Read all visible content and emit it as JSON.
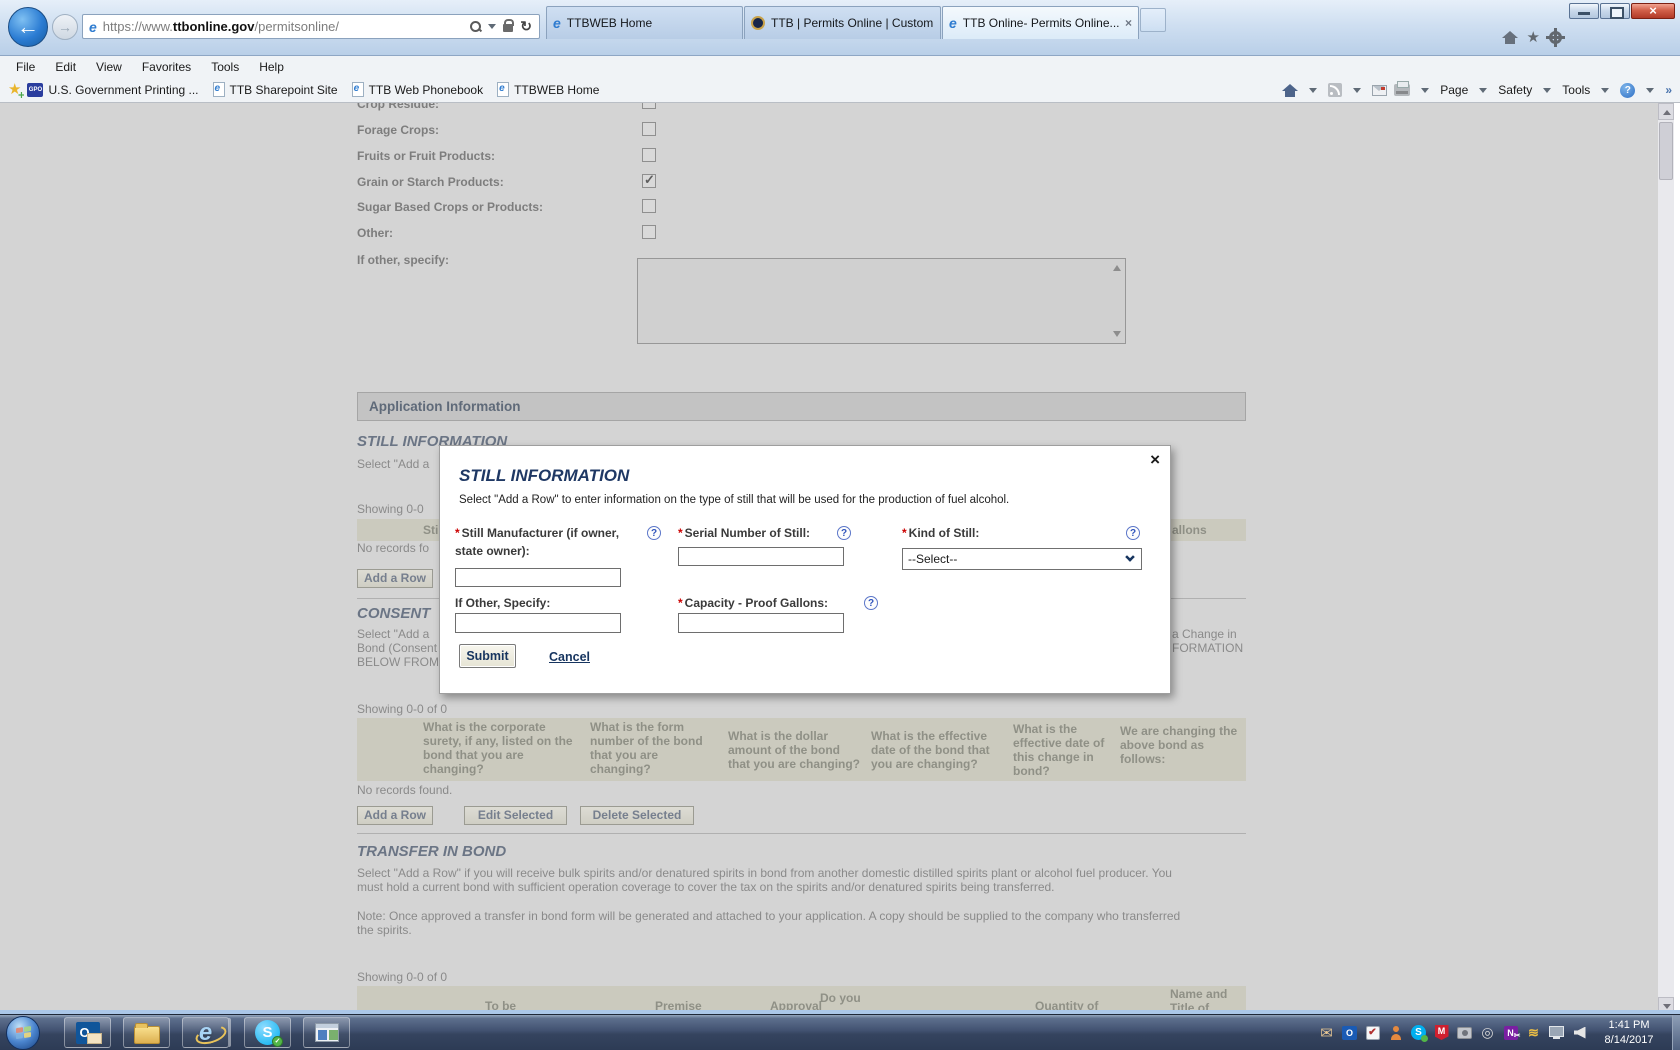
{
  "colors": {
    "accent_navy": "#1f3864",
    "required_red": "#cc0000",
    "help_blue": "#2f54bc",
    "page_dim_bg": "#d4d4d4",
    "band_bg": "#cbcabe",
    "chrome_blue": "#bfd4ea"
  },
  "icons": {
    "back": "←",
    "forward": "→",
    "refresh": "↻",
    "ie": "e",
    "star": "★",
    "check": "✓",
    "close_x": "×",
    "more": "»",
    "mail": "✉",
    "target": "◎",
    "swoosh": "≋",
    "scissors": "✂",
    "question": "?",
    "skype_s": "S",
    "outlook_o": "O",
    "mcafee_m": "M",
    "onenote_n": "N",
    "task_check": "✔"
  },
  "browser": {
    "address": {
      "prefix": "https://www.",
      "domain": "ttbonline.gov",
      "path": "/permitsonline/"
    },
    "tabs": [
      {
        "label": "TTBWEB Home"
      },
      {
        "label": "TTB | Permits Online | Custom..."
      },
      {
        "label": "TTB Online- Permits Online..."
      }
    ],
    "menu": [
      "File",
      "Edit",
      "View",
      "Favorites",
      "Tools",
      "Help"
    ],
    "favorites_badge": "GPO",
    "favorites": [
      "U.S. Government Printing ...",
      "TTB Sharepoint Site",
      "TTB Web Phonebook",
      "TTBWEB Home"
    ],
    "commands": {
      "page": "Page",
      "safety": "Safety",
      "tools": "Tools"
    }
  },
  "page": {
    "checkbox_rows": [
      {
        "label": "Crop Residue:",
        "checked": false
      },
      {
        "label": "Forage Crops:",
        "checked": false
      },
      {
        "label": "Fruits or Fruit Products:",
        "checked": false
      },
      {
        "label": "Grain or Starch Products:",
        "checked": true
      },
      {
        "label": "Sugar Based Crops or Products:",
        "checked": false
      },
      {
        "label": "Other:",
        "checked": false
      }
    ],
    "if_other_label": "If other, specify:",
    "app_info_title": "Application Information",
    "still": {
      "heading": "STILL INFORMATION",
      "intro_fragment": "Select \"Add a",
      "showing_fragment": "Showing 0-0",
      "header_left_fragment": "Stil",
      "header_right_fragment": "allons",
      "no_records_fragment": "No records fo",
      "add_row": "Add a Row"
    },
    "consent": {
      "heading_fragment": "CONSENT",
      "line1_left": "Select \"Add a",
      "line1_right": "a Change in",
      "line2_left": "Bond (Consent",
      "line2_right": "FORMATION",
      "line3_left": "BELOW FROM",
      "showing": "Showing 0-0 of 0",
      "columns": [
        "",
        "What is the corporate surety, if any, listed on the bond that you are changing?",
        "What is the form number of the bond that you are changing?",
        "What is the dollar amount of the bond that you are changing?",
        "What is the effective date of the bond that you are changing?",
        "What is the effective date of this change in bond?",
        "We are changing the above bond as follows:"
      ],
      "no_records": "No records found.",
      "add_row": "Add a Row",
      "edit": "Edit Selected",
      "delete": "Delete Selected"
    },
    "transfer": {
      "heading": "TRANSFER IN BOND",
      "para_line1": "Select \"Add a Row\" if you will receive bulk spirits and/or denatured spirits in bond from another domestic distilled spirits plant or alcohol fuel producer. You",
      "para_line2": "must hold a current bond with sufficient operation coverage to cover the tax on the spirits and/or denatured spirits being transferred.",
      "note_line1": "Note: Once approved a transfer in bond form will be generated and attached to your application. A copy should be supplied to the company who transferred",
      "note_line2": "the spirits.",
      "showing": "Showing 0-0 of 0",
      "header_fragments": [
        "To be",
        "Premise",
        "Approval",
        "Do you",
        "Quantity of",
        "Name and",
        "Title of"
      ]
    }
  },
  "modal": {
    "title": "STILL INFORMATION",
    "close": "×",
    "description": "Select \"Add a Row\" to enter information on the type of still that will be used for the production of fuel alcohol.",
    "asterisk": "*",
    "help_glyph": "?",
    "fields": {
      "manufacturer_label": "Still Manufacturer (if owner, state owner):",
      "serial_label": "Serial Number of Still:",
      "kind_label": "Kind of Still:",
      "kind_value": "--Select--",
      "if_other_label": "If Other, Specify:",
      "capacity_label": "Capacity - Proof Gallons:"
    },
    "submit": "Submit",
    "cancel": "Cancel"
  },
  "taskbar": {
    "time": "1:41 PM",
    "date": "8/14/2017"
  }
}
